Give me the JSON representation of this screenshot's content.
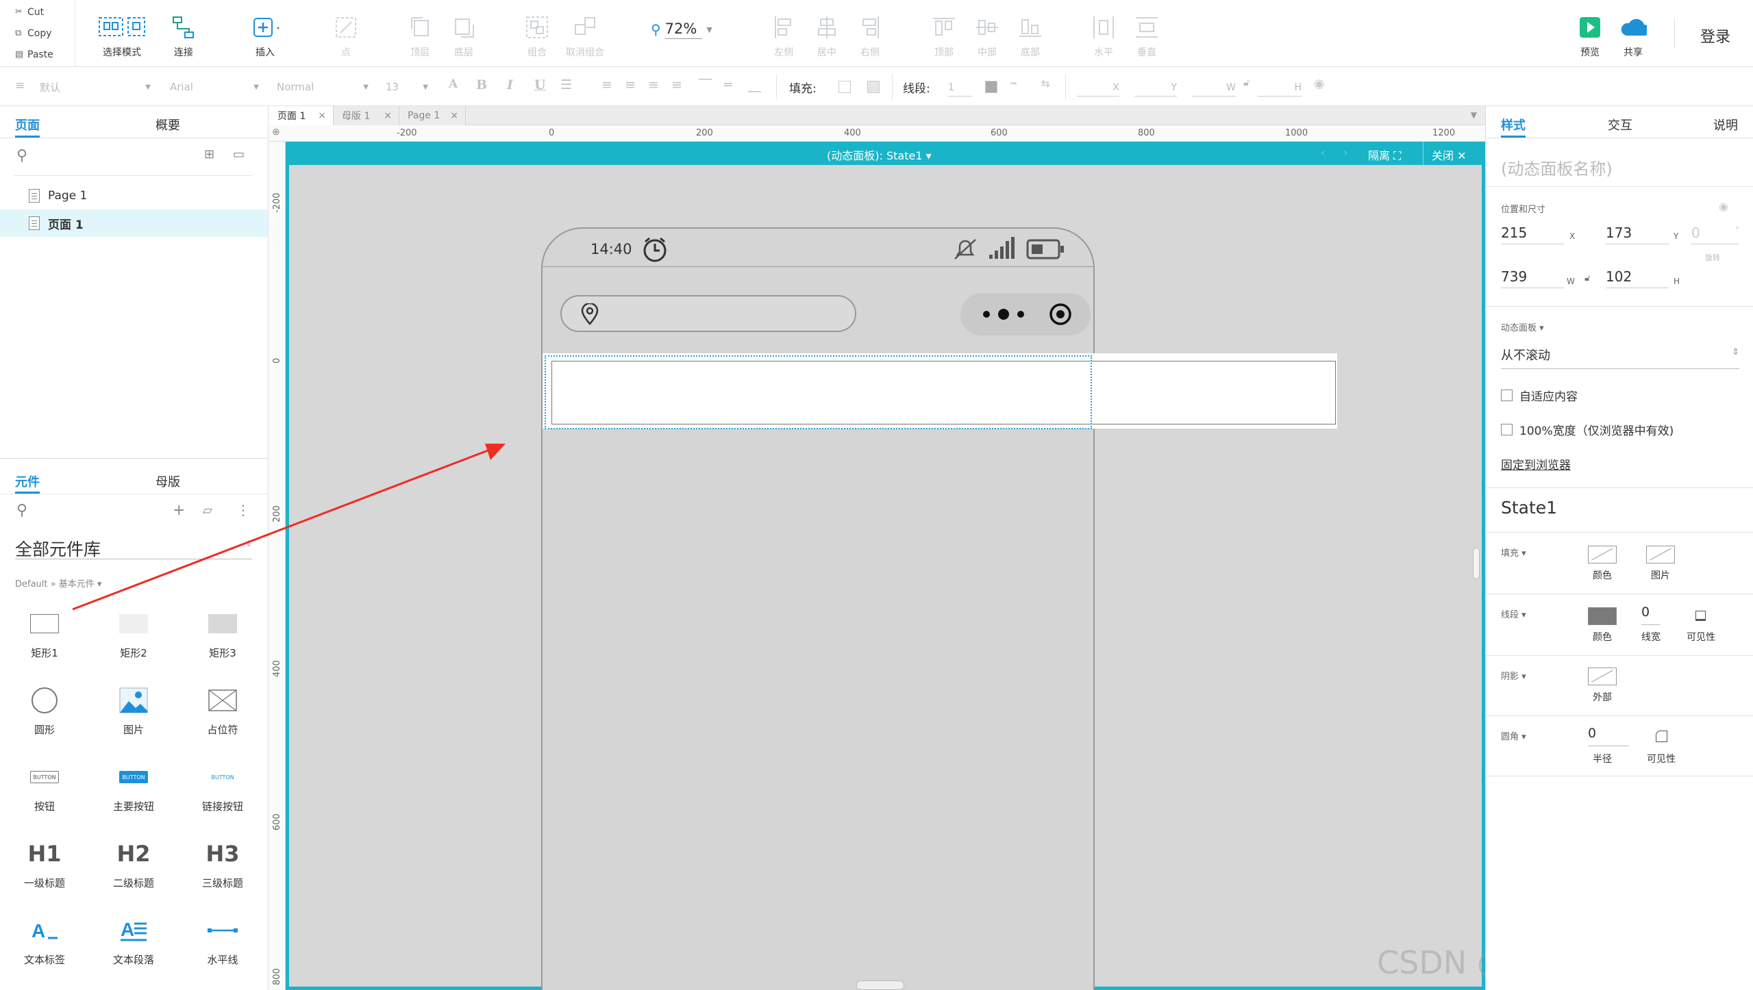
{
  "clipboard": {
    "cut": "Cut",
    "copy": "Copy",
    "paste": "Paste"
  },
  "toolbar": {
    "select_mode": "选择模式",
    "connect": "连接",
    "insert": "插入",
    "point": "点",
    "top_layer": "顶层",
    "bottom_layer": "底层",
    "group": "组合",
    "ungroup": "取消组合",
    "zoom": "72%",
    "align_left": "左侧",
    "align_center": "居中",
    "align_right": "右侧",
    "align_top": "顶部",
    "align_middle": "中部",
    "align_bottom": "底部",
    "distribute_h": "水平",
    "distribute_v": "垂直",
    "preview": "预览",
    "share": "共享",
    "login": "登录"
  },
  "format_bar": {
    "style": "默认",
    "font": "Arial",
    "weight": "Normal",
    "size": "13",
    "fill_label": "填充:",
    "stroke_label": "线段:",
    "stroke_value": "1",
    "x_label": "X",
    "y_label": "Y",
    "w_label": "W",
    "h_label": "H"
  },
  "left_panel": {
    "tabs": [
      "页面",
      "概要"
    ],
    "pages": [
      "Page 1",
      "页面 1"
    ],
    "lib_tabs": [
      "元件",
      "母版"
    ],
    "library_title": "全部元件库",
    "library_path": "Default » 基本元件",
    "widgets": [
      "矩形1",
      "矩形2",
      "矩形3",
      "圆形",
      "图片",
      "占位符",
      "按钮",
      "主要按钮",
      "链接按钮",
      "一级标题",
      "二级标题",
      "三级标题",
      "文本标签",
      "文本段落",
      "水平线"
    ],
    "heading_glyphs": [
      "H1",
      "H2",
      "H3"
    ],
    "button_glyph": "BUTTON"
  },
  "doc_tabs": [
    "页面 1",
    "母版 1",
    "Page 1"
  ],
  "ruler": {
    "h": [
      "-200",
      "0",
      "200",
      "400",
      "600",
      "800",
      "1000",
      "1200"
    ],
    "v": [
      "-200",
      "0",
      "200",
      "400",
      "600",
      "800"
    ]
  },
  "dynamic_panel": {
    "title": "(动态面板): State1",
    "isolate": "隔离",
    "close": "关闭"
  },
  "phone": {
    "time": "14:40"
  },
  "watermark": "CSDN @结构化知识课堂",
  "right_panel": {
    "tabs": [
      "样式",
      "交互",
      "说明"
    ],
    "name_placeholder": "(动态面板名称)",
    "pos_size_label": "位置和尺寸",
    "x": "215",
    "y": "173",
    "rotation": "0",
    "w": "739",
    "h": "102",
    "x_unit": "X",
    "y_unit": "Y",
    "w_unit": "W",
    "h_unit": "H",
    "rotation_label": "旋转",
    "dp_label": "动态面板",
    "scroll": "从不滚动",
    "fit_content": "自适应内容",
    "full_width": "100%宽度（仅浏览器中有效)",
    "pin": "固定到浏览器",
    "state": "State1",
    "fill_label": "填充",
    "fill_color": "颜色",
    "fill_image": "图片",
    "stroke_label": "线段",
    "stroke_color": "颜色",
    "stroke_width_value": "0",
    "stroke_width": "线宽",
    "stroke_visibility": "可见性",
    "shadow_label": "阴影",
    "shadow_outer": "外部",
    "corner_label": "圆角",
    "corner_value": "0",
    "corner_radius": "半径",
    "corner_visibility": "可见性"
  },
  "colors": {
    "accent": "#1e90d8",
    "panel_header": "#1ab4c8",
    "arrow": "#ee2d24"
  }
}
